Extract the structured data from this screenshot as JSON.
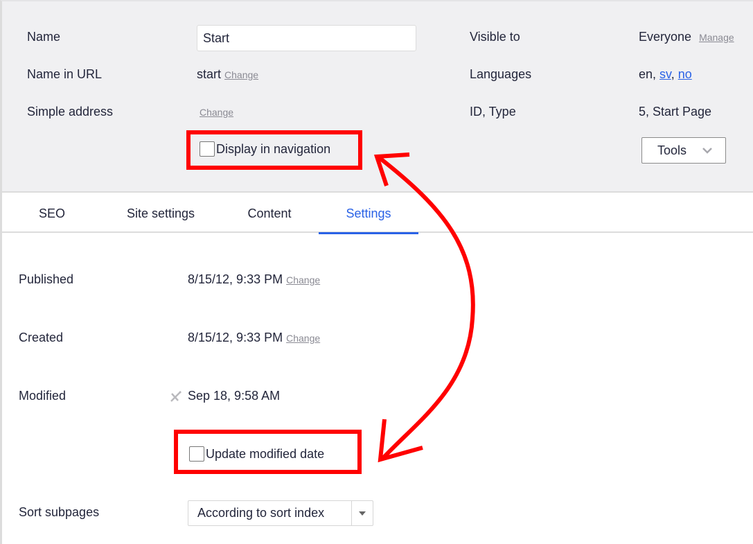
{
  "header": {
    "name_label": "Name",
    "name_value": "Start",
    "name_in_url_label": "Name in URL",
    "name_in_url_value": "start",
    "name_in_url_change": "Change",
    "simple_address_label": "Simple address",
    "simple_address_change": "Change",
    "display_in_navigation_label": "Display in navigation",
    "display_in_navigation_checked": false,
    "visible_to_label": "Visible to",
    "visible_to_value": "Everyone",
    "visible_to_manage": "Manage",
    "languages_label": "Languages",
    "languages": {
      "current": "en",
      "sep1": ", ",
      "link1": "sv",
      "sep2": ", ",
      "link2": "no"
    },
    "id_type_label": "ID, Type",
    "id_type_value": "5, Start Page",
    "tools_label": "Tools"
  },
  "tabs": [
    {
      "label": "SEO",
      "active": false
    },
    {
      "label": "Site settings",
      "active": false
    },
    {
      "label": "Content",
      "active": false
    },
    {
      "label": "Settings",
      "active": true
    }
  ],
  "settings": {
    "published_label": "Published",
    "published_value": "8/15/12, 9:33 PM",
    "published_change": "Change",
    "created_label": "Created",
    "created_value": "8/15/12, 9:33 PM",
    "created_change": "Change",
    "modified_label": "Modified",
    "modified_value": "Sep 18, 9:58 AM",
    "modified_icon": "unpin-icon",
    "update_modified_label": "Update modified date",
    "update_modified_checked": false,
    "sort_subpages_label": "Sort subpages",
    "sort_subpages_value": "According to sort index"
  },
  "annotation": {
    "color": "#ff0000",
    "description": "double-headed arrow linking highlighted checkboxes"
  },
  "colors": {
    "accent": "#2a62e6",
    "header_bg": "#f0f0f2",
    "highlight": "#ff0000"
  }
}
